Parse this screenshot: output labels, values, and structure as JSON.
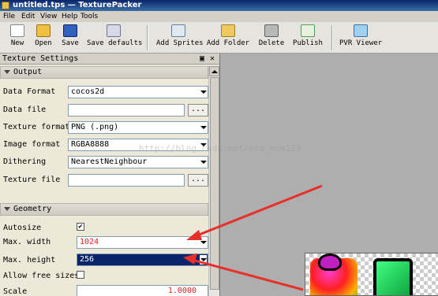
{
  "window": {
    "title": "untitled.tps — TexturePacker"
  },
  "menu": [
    "File",
    "Edit",
    "View",
    "Help",
    "Tools"
  ],
  "toolbar": {
    "new": "New",
    "open": "Open",
    "save": "Save",
    "save_defaults": "Save defaults",
    "add_sprites": "Add Sprites",
    "add_folder": "Add Folder",
    "delete": "Delete",
    "publish": "Publish",
    "pvr_viewer": "PVR Viewer"
  },
  "panel": {
    "title": "Texture Settings",
    "output": {
      "header": "Output",
      "data_format_label": "Data Format",
      "data_format_value": "cocos2d",
      "data_file_label": "Data file",
      "data_file_value": "",
      "texture_format_label": "Texture format",
      "texture_format_value": "PNG (.png)",
      "image_format_label": "Image format",
      "image_format_value": "RGBA8888",
      "dithering_label": "Dithering",
      "dithering_value": "NearestNeighbour",
      "texture_file_label": "Texture file",
      "texture_file_value": "",
      "browse": "..."
    },
    "geometry": {
      "header": "Geometry",
      "autosize_label": "Autosize",
      "autosize_checked": "✔",
      "max_width_label": "Max. width",
      "max_width_value": "1024",
      "max_height_label": "Max. height",
      "max_height_value": "256",
      "allow_free_sizes_label": "Allow free sizes",
      "scale_label": "Scale",
      "scale_value": "1.0000"
    }
  },
  "watermark": "http://blog.csdn.net/ess_xcm123",
  "colors": {
    "arrow": "#e8302a",
    "selection": "#0a246a"
  }
}
